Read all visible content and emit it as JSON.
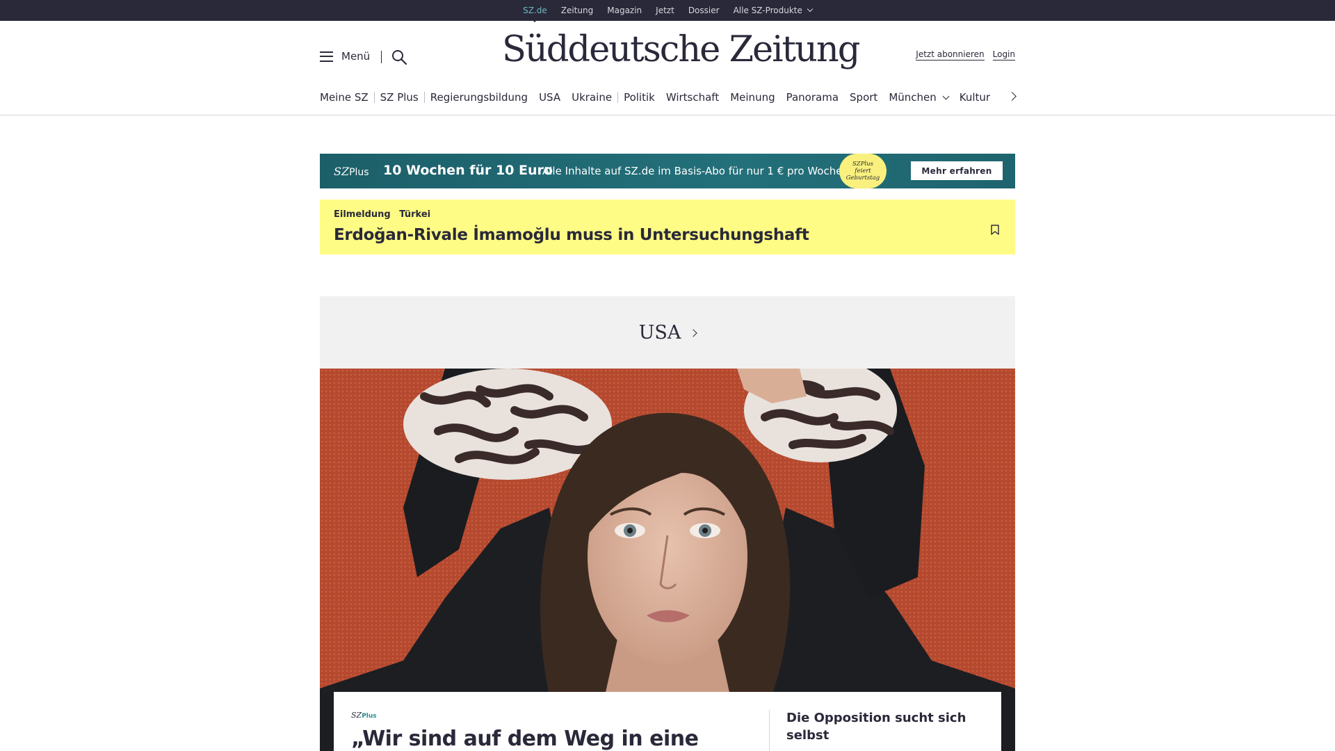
{
  "topbar": {
    "items": [
      "SZ.de",
      "Zeitung",
      "Magazin",
      "Jetzt",
      "Dossier",
      "Alle SZ-Produkte"
    ],
    "active_color": "#6fb7bd",
    "background": "#29293a"
  },
  "header": {
    "menu_label": "Menü",
    "logo": "Süddeutsche Zeitung",
    "subscribe_link": "Jetzt abonnieren",
    "login_link": "Login"
  },
  "sections": [
    "Meine SZ",
    "SZ Plus",
    "Regierungsbildung",
    "USA",
    "Ukraine",
    "Politik",
    "Wirtschaft",
    "Meinung",
    "Panorama",
    "Sport",
    "München",
    "Kultur"
  ],
  "promo": {
    "brand_sz": "SZ",
    "brand_plus": "Plus",
    "headline": "10 Wochen für 10 Euro",
    "text": "Alle Inhalte auf SZ.de im Basis-Abo für nur 1 € pro Woche.",
    "badge_line1": "SZPlus",
    "badge_line2": "feiert",
    "badge_line3": "Geburtstag",
    "cta": "Mehr erfahren",
    "background": "#1e646e"
  },
  "breaking": {
    "kicker_1": "Eilmeldung",
    "kicker_2": "Türkei",
    "title": "Erdoğan-Rivale İmamoğlu muss in Untersuchungshaft",
    "background": "#fffc85"
  },
  "section_block": {
    "label": "USA"
  },
  "teaser": {
    "plus_sz": "SZ",
    "plus_label": "Plus",
    "headline": "„Wir sind auf dem Weg in eine",
    "side_headline": "Die Opposition sucht sich selbst"
  }
}
